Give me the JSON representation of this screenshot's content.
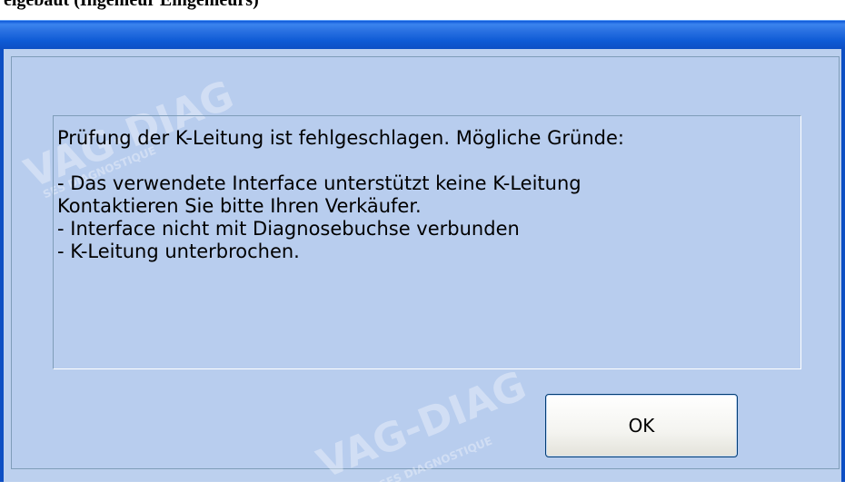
{
  "header_caption": "eigebaut (Ingenieur Eingenieurs)",
  "dialog": {
    "message_lines": [
      "Prüfung der K-Leitung ist fehlgeschlagen. Mögliche Gründe:",
      "",
      "- Das verwendete Interface unterstützt keine K-Leitung",
      "Kontaktieren Sie bitte Ihren Verkäufer.",
      "- Interface nicht mit Diagnosebuchse verbunden",
      "- K-Leitung unterbrochen."
    ],
    "ok_label": "OK"
  },
  "watermark": {
    "brand": "VAG-DIAG",
    "sub": "SES DIAGNOSTIQUE"
  },
  "colors": {
    "titlebar": "#0d4fc4",
    "window_body": "#bcd0ee",
    "ok_border": "#003c74"
  }
}
